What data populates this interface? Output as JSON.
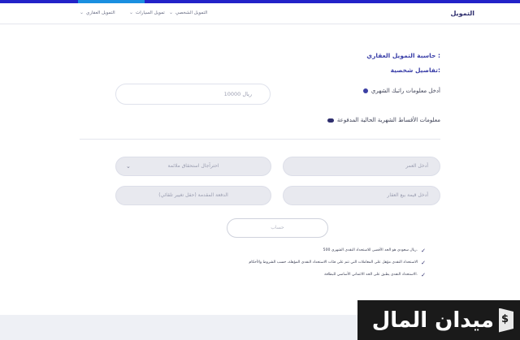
{
  "nav": {
    "brand": "التمويل",
    "items": [
      {
        "label": "التمويل العقاري"
      },
      {
        "label": "تمويل السيارات"
      },
      {
        "label": "التمويل الشخصي"
      }
    ]
  },
  "form": {
    "title": "حاسبة التمويل العقاري :",
    "subtitle": "تفاصيل شخصية:",
    "salary_question": "أدخل معلومات راتبك الشهري",
    "salary_value": "ريال 10000",
    "installments_question": "معلومات الأقساط الشهرية الحالية المدفوعة",
    "age_placeholder": "أدخل العمر",
    "select_value": "احترآجال استحقاق ملائمة",
    "property_value_placeholder": "أدخل قيمة بيع العقار",
    "down_payment_placeholder": "الدفعة المقدمة (حقل تغيير تلقائي)",
    "calc_label": "حساب"
  },
  "notes": [
    "500 ريال سعودي هو الحد الأقصى للاستحداد النقدي الشهري.",
    "الاستحداد النقدي مؤهل على المعاملات التي تتم على فئات الاستحداد النقدي المؤهلة، حسب الشروط والأحكام",
    "الاستحداد النقدي يطبق على الحد الائتماني الأساسي للبطاقة."
  ],
  "logo": {
    "text": "ميدان المال"
  },
  "colors": {
    "accent": "#3a3fa8",
    "topbar": "#2323c8",
    "dark": "#1a1a1a"
  }
}
